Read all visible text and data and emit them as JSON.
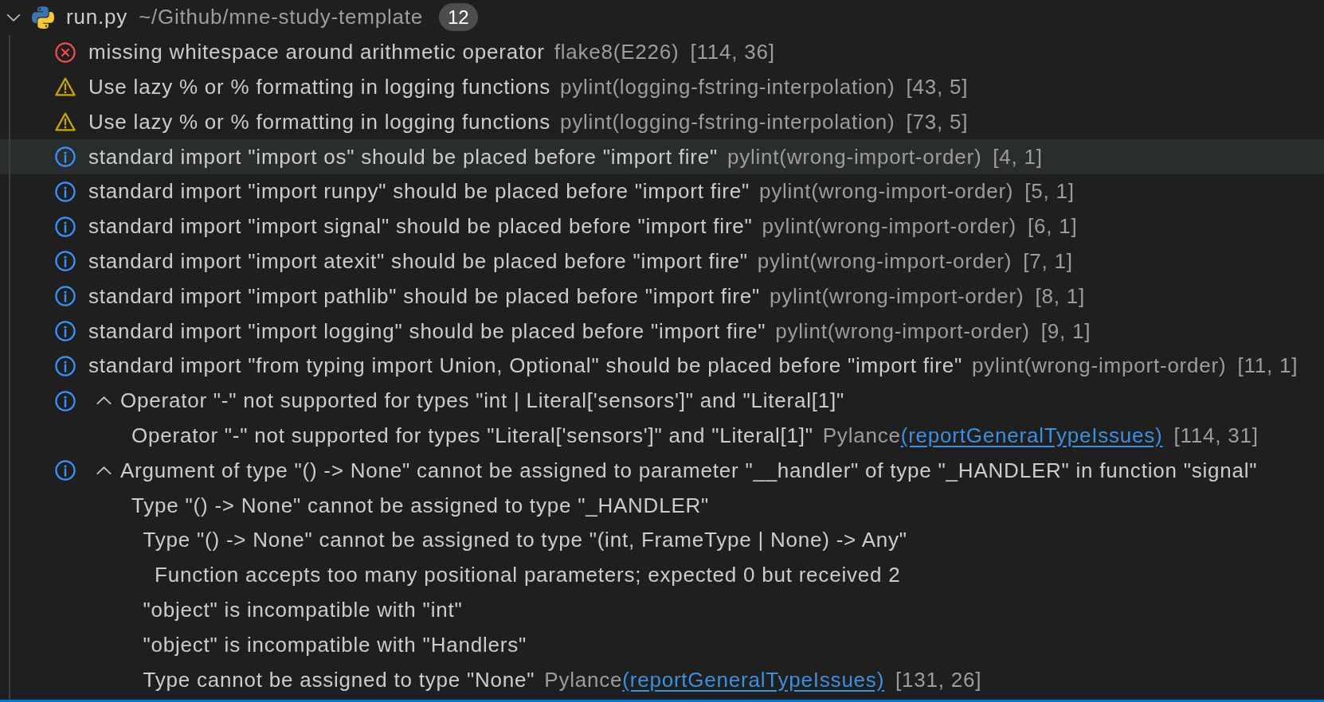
{
  "file": {
    "expanded": true,
    "name": "run.py",
    "path": "~/Github/mne-study-template",
    "count": "12"
  },
  "problems": [
    {
      "kind": "error",
      "hovered": false,
      "message": "missing whitespace around arithmetic operator",
      "source": "flake8(E226)",
      "position": "[114, 36]"
    },
    {
      "kind": "warning",
      "hovered": false,
      "message": "Use lazy % or % formatting in logging functions",
      "source": "pylint(logging-fstring-interpolation)",
      "position": "[43, 5]"
    },
    {
      "kind": "warning",
      "hovered": false,
      "message": "Use lazy % or % formatting in logging functions",
      "source": "pylint(logging-fstring-interpolation)",
      "position": "[73, 5]"
    },
    {
      "kind": "info",
      "hovered": true,
      "message": "standard import \"import os\" should be placed before \"import fire\"",
      "source": "pylint(wrong-import-order)",
      "position": "[4, 1]"
    },
    {
      "kind": "info",
      "hovered": false,
      "message": "standard import \"import runpy\" should be placed before \"import fire\"",
      "source": "pylint(wrong-import-order)",
      "position": "[5, 1]"
    },
    {
      "kind": "info",
      "hovered": false,
      "message": "standard import \"import signal\" should be placed before \"import fire\"",
      "source": "pylint(wrong-import-order)",
      "position": "[6, 1]"
    },
    {
      "kind": "info",
      "hovered": false,
      "message": "standard import \"import atexit\" should be placed before \"import fire\"",
      "source": "pylint(wrong-import-order)",
      "position": "[7, 1]"
    },
    {
      "kind": "info",
      "hovered": false,
      "message": "standard import \"import pathlib\" should be placed before \"import fire\"",
      "source": "pylint(wrong-import-order)",
      "position": "[8, 1]"
    },
    {
      "kind": "info",
      "hovered": false,
      "message": "standard import \"import logging\" should be placed before \"import fire\"",
      "source": "pylint(wrong-import-order)",
      "position": "[9, 1]"
    },
    {
      "kind": "info",
      "hovered": false,
      "message": "standard import \"from typing import Union, Optional\" should be placed before \"import fire\"",
      "source": "pylint(wrong-import-order)",
      "position": "[11, 1]"
    },
    {
      "kind": "info",
      "hovered": false,
      "expanded": true,
      "message": "Operator \"-\" not supported for types \"int | Literal['sensors']\" and \"Literal[1]\"",
      "children": [
        {
          "text": "Operator \"-\" not supported for types \"Literal['sensors']\" and \"Literal[1]\""
        }
      ],
      "source": "Pylance",
      "code": "(reportGeneralTypeIssues)",
      "position": "[114, 31]"
    },
    {
      "kind": "info",
      "hovered": false,
      "expanded": true,
      "message": "Argument of type \"() -> None\" cannot be assigned to parameter \"__handler\" of type \"_HANDLER\" in function \"signal\"",
      "children": [
        {
          "text": "Type \"() -> None\" cannot be assigned to type \"_HANDLER\"",
          "children": [
            {
              "text": "Type \"() -> None\" cannot be assigned to type \"(int, FrameType | None) -> Any\"",
              "children": [
                {
                  "text": "Function accepts too many positional parameters; expected 0 but received 2"
                }
              ]
            },
            {
              "text": "\"object\" is incompatible with \"int\""
            },
            {
              "text": "\"object\" is incompatible with \"Handlers\""
            },
            {
              "text": "Type cannot be assigned to type \"None\""
            }
          ]
        }
      ],
      "source": "Pylance",
      "code": "(reportGeneralTypeIssues)",
      "position": "[131, 26]"
    }
  ]
}
